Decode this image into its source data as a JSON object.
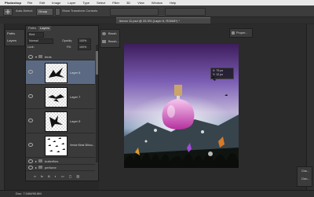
{
  "menubar": {
    "app": "Photoshop",
    "items": [
      "File",
      "Edit",
      "Image",
      "Layer",
      "Type",
      "Select",
      "Filter",
      "3D",
      "View",
      "Window",
      "Help"
    ]
  },
  "options": {
    "auto_select_label": "Auto-Select:",
    "auto_select_value": "Group",
    "show_transform": "Show Transform Controls"
  },
  "document": {
    "tab_title": "lemon 11.psd @ 33.3% (Layer 6, RGB/8*) *"
  },
  "mini_panel": {
    "items": [
      "Paths",
      "Layers"
    ]
  },
  "layers_panel": {
    "tabs": [
      "Paths",
      "Layers"
    ],
    "kind_value": "Kind",
    "blend_value": "Normal",
    "opacity_label": "Opacity:",
    "opacity_value": "100%",
    "lock_label": "Lock:",
    "fill_label": "Fill:",
    "fill_value": "100%",
    "group_top": "birds",
    "layers": [
      {
        "name": "Layer 6",
        "selected": true
      },
      {
        "name": "Layer 7",
        "selected": false
      },
      {
        "name": "Layer 5",
        "selected": false
      },
      {
        "name": "Vector Birds Silhou...",
        "selected": false
      }
    ],
    "groups_bottom": [
      "butterflies",
      "perfume"
    ]
  },
  "brush_panel": {
    "items": [
      "Brush",
      "Brush..."
    ]
  },
  "properties_label": "Proper...",
  "info_readout": {
    "x": "X: 79 px",
    "y": "Y: 12 px"
  },
  "right_panel": {
    "items": [
      "Cha...",
      "Clon..."
    ]
  },
  "status": {
    "text": "Doc: 7.04M/90.8M"
  },
  "colors": {
    "accent": "#7b5db3",
    "bg": "#282828"
  }
}
